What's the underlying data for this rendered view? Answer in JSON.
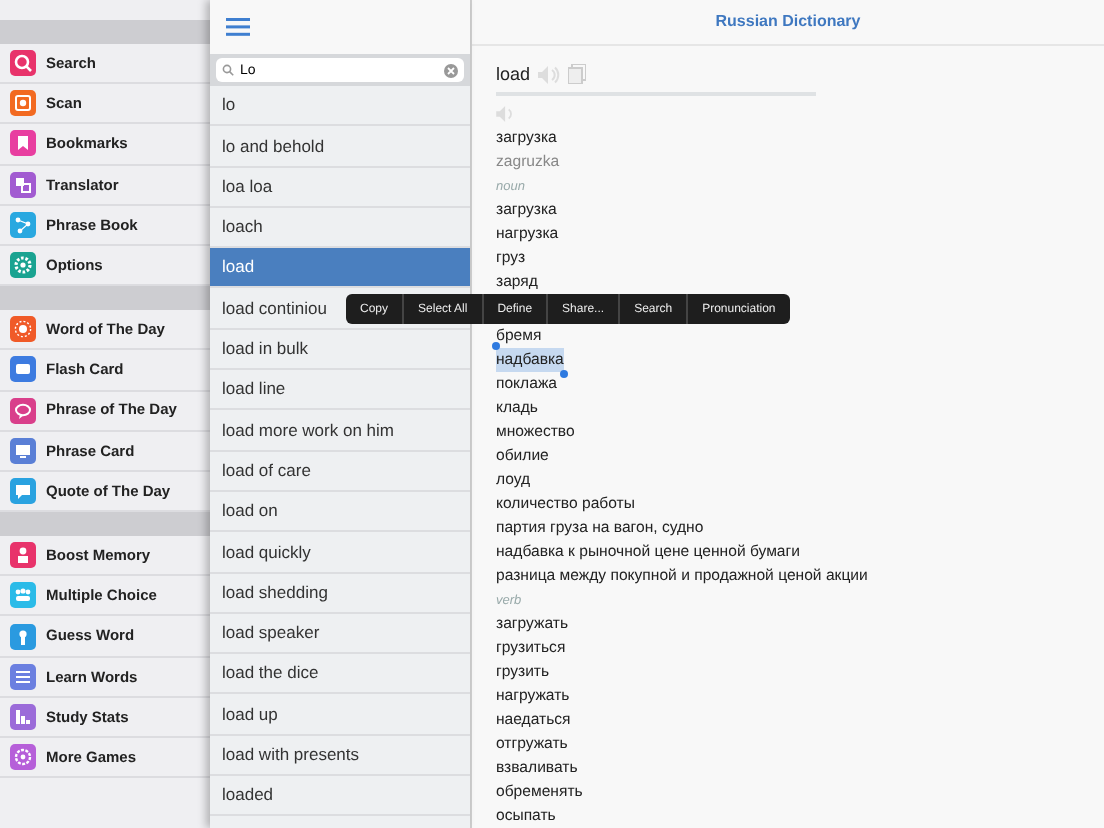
{
  "sidebar": {
    "groups": [
      {
        "items": [
          {
            "label": "Search",
            "color": "#e8336b"
          },
          {
            "label": "Scan",
            "color": "#f26a21"
          },
          {
            "label": "Bookmarks",
            "color": "#e83ea0"
          },
          {
            "label": "Translator",
            "color": "#a25bd1"
          },
          {
            "label": "Phrase Book",
            "color": "#29a8e0"
          },
          {
            "label": "Options",
            "color": "#1aa391"
          }
        ]
      },
      {
        "items": [
          {
            "label": "Word of The Day",
            "color": "#f05a28"
          },
          {
            "label": "Flash Card",
            "color": "#3d7be0"
          },
          {
            "label": "Phrase of The Day",
            "color": "#d93f8b"
          },
          {
            "label": "Phrase Card",
            "color": "#5a7fd6"
          },
          {
            "label": "Quote of The Day",
            "color": "#2aa2e0"
          }
        ]
      },
      {
        "items": [
          {
            "label": "Boost Memory",
            "color": "#e8336b"
          },
          {
            "label": "Multiple Choice",
            "color": "#2bbbe8"
          },
          {
            "label": "Guess Word",
            "color": "#2a9ae0"
          },
          {
            "label": "Learn Words",
            "color": "#6b7fe0"
          },
          {
            "label": "Study Stats",
            "color": "#9b6bd9"
          },
          {
            "label": "More Games",
            "color": "#b65fd9"
          }
        ]
      }
    ]
  },
  "search": {
    "value": "Lo"
  },
  "results": [
    {
      "label": "lo",
      "selected": false
    },
    {
      "label": "lo and behold",
      "selected": false
    },
    {
      "label": "loa loa",
      "selected": false
    },
    {
      "label": "loach",
      "selected": false
    },
    {
      "label": "load",
      "selected": true
    },
    {
      "label": "load continiou",
      "selected": false
    },
    {
      "label": "load in bulk",
      "selected": false
    },
    {
      "label": "load line",
      "selected": false
    },
    {
      "label": "load more work on him",
      "selected": false
    },
    {
      "label": "load of care",
      "selected": false
    },
    {
      "label": "load on",
      "selected": false
    },
    {
      "label": "load quickly",
      "selected": false
    },
    {
      "label": "load shedding",
      "selected": false
    },
    {
      "label": "load speaker",
      "selected": false
    },
    {
      "label": "load the dice",
      "selected": false
    },
    {
      "label": "load up",
      "selected": false
    },
    {
      "label": "load with presents",
      "selected": false
    },
    {
      "label": "loaded",
      "selected": false
    }
  ],
  "title": "Russian Dictionary",
  "entry": {
    "word": "load",
    "translation": "загрузка",
    "transliteration": "zagruzka",
    "sections": [
      {
        "pos": "noun",
        "words": [
          {
            "text": "загрузка",
            "selected": false
          },
          {
            "text": "нагрузка",
            "selected": false
          },
          {
            "text": "груз",
            "selected": false
          },
          {
            "text": "заряд",
            "selected": false
          },
          {
            "kind": "menu"
          },
          {
            "text": "бремя",
            "selected": false
          },
          {
            "text": "надбавка",
            "selected": true
          },
          {
            "text": "поклажа",
            "selected": false
          },
          {
            "text": "кладь",
            "selected": false
          },
          {
            "text": "множество",
            "selected": false
          },
          {
            "text": "обилие",
            "selected": false
          },
          {
            "text": "лоуд",
            "selected": false
          },
          {
            "text": "количество работы",
            "selected": false
          },
          {
            "text": "партия груза на вагон, судно",
            "selected": false
          },
          {
            "text": "надбавка к рыночной цене ценной бумаги",
            "selected": false
          },
          {
            "text": "разница между покупной и продажной ценой акции",
            "selected": false
          }
        ]
      },
      {
        "pos": "verb",
        "words": [
          {
            "text": "загружать",
            "selected": false
          },
          {
            "text": "грузиться",
            "selected": false
          },
          {
            "text": "грузить",
            "selected": false
          },
          {
            "text": "нагружать",
            "selected": false
          },
          {
            "text": "наедаться",
            "selected": false
          },
          {
            "text": "отгружать",
            "selected": false
          },
          {
            "text": "взваливать",
            "selected": false
          },
          {
            "text": "обременять",
            "selected": false
          },
          {
            "text": "осыпать",
            "selected": false
          }
        ]
      }
    ]
  },
  "menu": [
    "Copy",
    "Select All",
    "Define",
    "Share...",
    "Search",
    "Pronunciation"
  ]
}
